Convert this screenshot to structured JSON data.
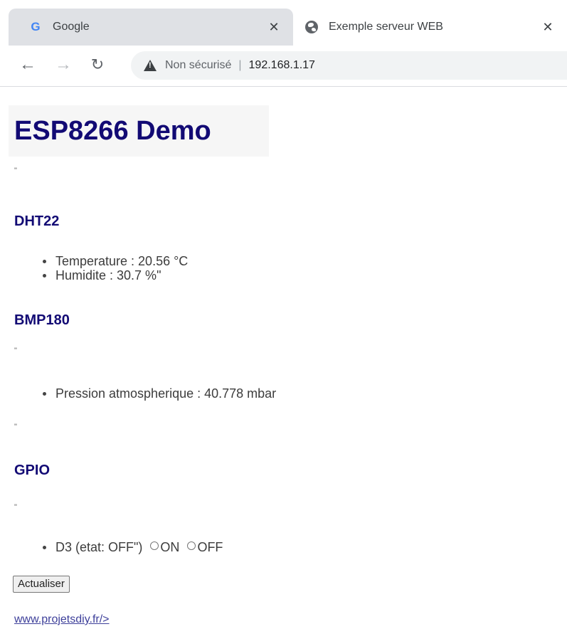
{
  "browser": {
    "tabs": [
      {
        "title": "Google",
        "icon": "google-icon"
      },
      {
        "title": "Exemple serveur WEB",
        "icon": "globe-icon"
      }
    ],
    "close_glyph": "✕",
    "nav": {
      "back": "←",
      "forward": "→",
      "reload": "↻"
    },
    "address": {
      "security_label": "Non sécurisé",
      "separator": "|",
      "url": "192.168.1.17"
    }
  },
  "page": {
    "title": "ESP8266 Demo",
    "stray_quote": "\"",
    "dht": {
      "heading": "DHT22",
      "items": [
        "Temperature : 20.56 °C",
        "Humidite : 30.7 %\""
      ]
    },
    "bmp": {
      "heading": "BMP180",
      "items": [
        "Pression atmospherique : 40.778 mbar"
      ]
    },
    "gpio": {
      "heading": "GPIO",
      "item_label": "D3 (etat: OFF\")",
      "radio_on": "ON",
      "radio_off": "OFF"
    },
    "refresh_button": "Actualiser",
    "footer_link": "www.projetsdiy.fr/>"
  }
}
